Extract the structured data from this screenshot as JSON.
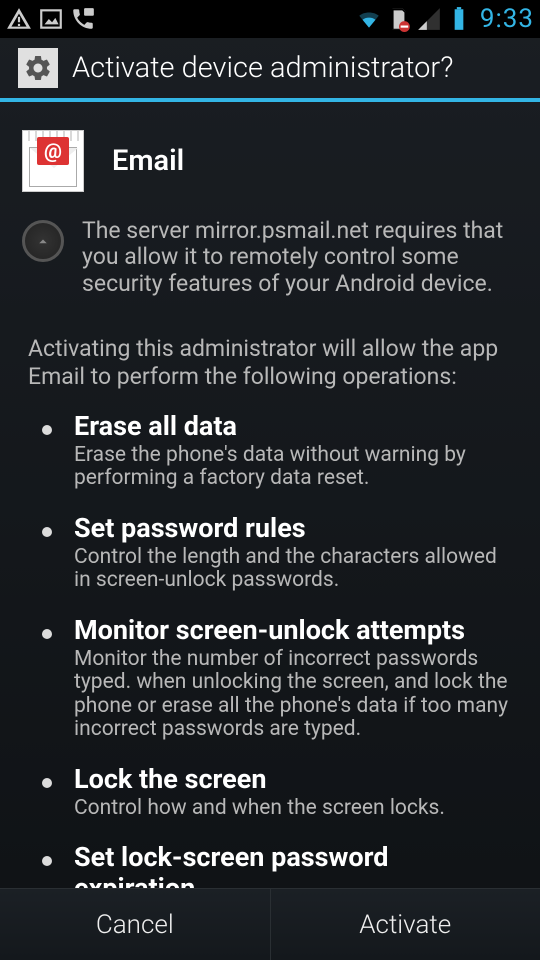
{
  "status": {
    "left_icons": [
      "warning-icon",
      "picture-icon",
      "voicemail-icon"
    ],
    "right_icons": [
      "wifi-icon",
      "storage-warn-icon",
      "signal-icon",
      "battery-icon"
    ],
    "time": "9:33"
  },
  "title": "Activate device administrator?",
  "app": {
    "name": "Email"
  },
  "server_message": "The server mirror.psmail.net requires that you allow it to remotely control some security features of your Android device.",
  "intro": "Activating this administrator will allow the app Email to perform the following operations:",
  "operations": [
    {
      "title": "Erase all data",
      "desc": "Erase the phone's data without warning by performing a factory data reset."
    },
    {
      "title": "Set password rules",
      "desc": "Control the length and the characters allowed in screen-unlock passwords."
    },
    {
      "title": "Monitor screen-unlock attempts",
      "desc": "Monitor the number of incorrect passwords typed. when unlocking the screen, and lock the phone or erase all the phone's data if too many incorrect passwords are typed."
    },
    {
      "title": "Lock the screen",
      "desc": "Control how and when the screen locks."
    },
    {
      "title": "Set lock-screen password expiration",
      "desc": ""
    }
  ],
  "buttons": {
    "cancel": "Cancel",
    "activate": "Activate"
  }
}
